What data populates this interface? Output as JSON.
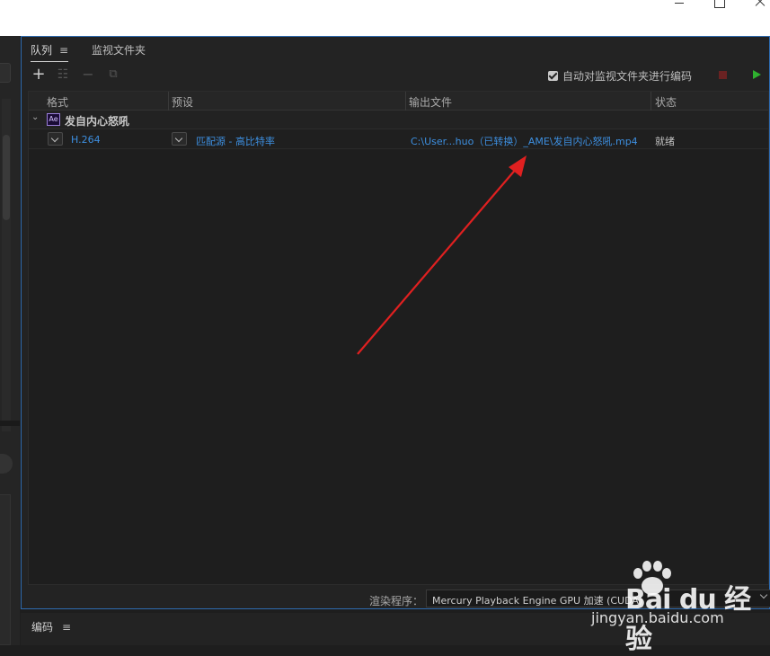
{
  "window": {
    "controls": [
      "minimize",
      "maximize",
      "close"
    ]
  },
  "queue_panel": {
    "tabs": [
      {
        "label": "队列",
        "menu": "≡"
      },
      {
        "label": "监视文件夹"
      }
    ],
    "toolbar": {
      "auto_encode_label": "自动对监视文件夹进行编码",
      "auto_encode_checked": true,
      "icons": [
        "plus-icon",
        "settings-icon",
        "minus-icon",
        "duplicate-icon",
        "stop-icon",
        "play-icon"
      ]
    },
    "columns": [
      "格式",
      "预设",
      "输出文件",
      "状态"
    ],
    "group": {
      "badge": "Ae",
      "title": "发自内心怒吼"
    },
    "items": [
      {
        "format": "H.264",
        "preset": "匹配源 - 高比特率",
        "output": "C:\\User...huo（已转换）_AME\\发自内心怒吼.mp4",
        "status": "就绪"
      }
    ],
    "renderer": {
      "label": "渲染程序：",
      "value": "Mercury Playback Engine GPU 加速 (CUDA)"
    }
  },
  "encode_panel": {
    "label": "编码",
    "menu": "≡"
  },
  "watermark": {
    "brand": "Bai du 经验",
    "url": "jingyan.baidu.com"
  },
  "colors": {
    "accent": "#2e6bb0",
    "link": "#3d8fe0",
    "arrow": "#e02020",
    "play": "#2fb12f",
    "stop": "#6a2222"
  }
}
